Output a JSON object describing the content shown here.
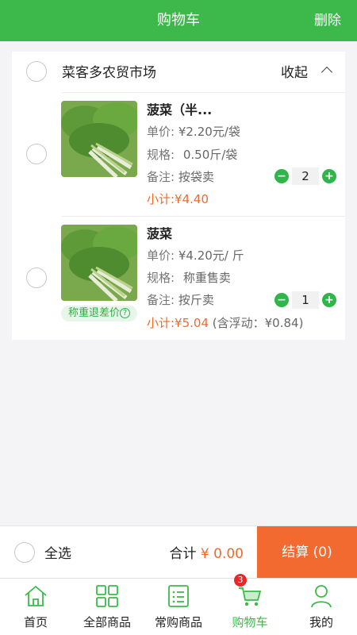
{
  "header": {
    "title": "购物车",
    "delete_label": "删除"
  },
  "store": {
    "name": "菜客多农贸市场",
    "collapse_label": "收起"
  },
  "items": [
    {
      "name": "菠菜（半...",
      "price_label": "单价:",
      "price": "¥2.20元/袋",
      "spec_label": "规格:",
      "spec": "0.50斤/袋",
      "note_label": "备注:",
      "note": "按袋卖",
      "quantity": "2",
      "subtotal": "小计:¥4.40"
    },
    {
      "name": "菠菜",
      "price_label": "单价:",
      "price": "¥4.20元/ 斤",
      "spec_label": "规格:",
      "spec": "称重售卖",
      "note_label": "备注:",
      "note": "按斤卖",
      "quantity": "1",
      "subtotal": "小计:¥5.04",
      "float_note": "(含浮动：¥0.84)",
      "tag": "称重退差价",
      "tag_help": "?"
    }
  ],
  "footer": {
    "select_all": "全选",
    "total_label": "合计",
    "total_amount": "¥ 0.00",
    "checkout": "结算 (0)"
  },
  "tabs": [
    {
      "label": "首页",
      "icon": "home-icon"
    },
    {
      "label": "全部商品",
      "icon": "grid-icon"
    },
    {
      "label": "常购商品",
      "icon": "list-icon"
    },
    {
      "label": "购物车",
      "icon": "cart-icon",
      "active": true,
      "badge": "3"
    },
    {
      "label": "我的",
      "icon": "user-icon"
    }
  ],
  "colors": {
    "brand_green": "#3db94b",
    "accent_orange": "#f26a2f",
    "badge_red": "#e9262b"
  }
}
